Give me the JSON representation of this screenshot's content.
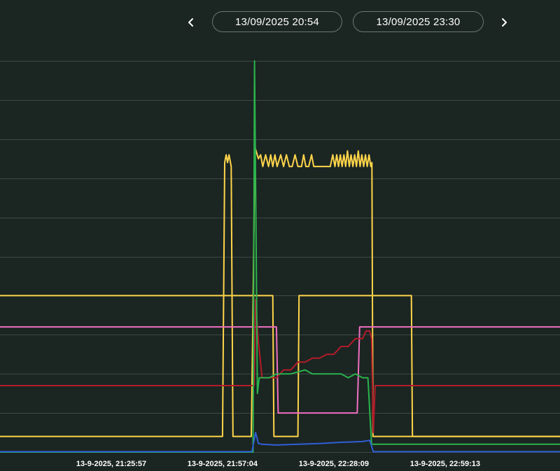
{
  "header": {
    "start_date": "13/09/2025 20:54",
    "end_date": "13/09/2025 23:30",
    "prev_icon": "chevron-left-icon",
    "next_icon": "chevron-right-icon"
  },
  "chart_data": {
    "type": "line",
    "title": "",
    "xlabel": "",
    "ylabel": "",
    "x_tick_labels": [
      "13-9-2025, 21:25:57",
      "13-9-2025, 21:57:04",
      "13-9-2025, 22:28:09",
      "13-9-2025, 22:59:13"
    ],
    "x_range_minutes": [
      -31,
      125
    ],
    "y_range": [
      0,
      10
    ],
    "grid": true,
    "legend": "none",
    "series": [
      {
        "color": "#ffd54a",
        "points": [
          [
            -31,
            4.0
          ],
          [
            45,
            4.0
          ],
          [
            45.3,
            0.4
          ],
          [
            52,
            0.4
          ],
          [
            52.3,
            4.0
          ],
          [
            83.6,
            4.0
          ],
          [
            83.9,
            0.4
          ],
          [
            125,
            0.4
          ]
        ]
      },
      {
        "color": "#ffd54a",
        "points": [
          [
            -31,
            0.4
          ],
          [
            31,
            0.4
          ],
          [
            31.6,
            7.4
          ],
          [
            32,
            7.6
          ],
          [
            32.4,
            7.4
          ],
          [
            32.8,
            7.6
          ],
          [
            33.4,
            7.3
          ],
          [
            33.9,
            0.4
          ],
          [
            39,
            0.4
          ],
          [
            39.4,
            3.0
          ],
          [
            40,
            7.8
          ],
          [
            41,
            7.5
          ],
          [
            41.6,
            7.6
          ],
          [
            42.2,
            7.3
          ],
          [
            43,
            7.6
          ],
          [
            43.8,
            7.3
          ],
          [
            44.4,
            7.6
          ],
          [
            45,
            7.3
          ],
          [
            45.6,
            7.6
          ],
          [
            46.2,
            7.3
          ],
          [
            47.2,
            7.6
          ],
          [
            48,
            7.3
          ],
          [
            48.8,
            7.6
          ],
          [
            49.6,
            7.3
          ],
          [
            50.4,
            7.3
          ],
          [
            51.2,
            7.6
          ],
          [
            52,
            7.3
          ],
          [
            53,
            7.3
          ],
          [
            53.6,
            7.6
          ],
          [
            54.2,
            7.3
          ],
          [
            55,
            7.3
          ],
          [
            55.8,
            7.6
          ],
          [
            56.4,
            7.3
          ],
          [
            58,
            7.3
          ],
          [
            60,
            7.3
          ],
          [
            61,
            7.3
          ],
          [
            61.7,
            7.6
          ],
          [
            62.3,
            7.3
          ],
          [
            62.8,
            7.6
          ],
          [
            63.3,
            7.3
          ],
          [
            63.8,
            7.6
          ],
          [
            64.3,
            7.3
          ],
          [
            64.8,
            7.6
          ],
          [
            65.3,
            7.3
          ],
          [
            65.8,
            7.7
          ],
          [
            66.3,
            7.3
          ],
          [
            66.8,
            7.6
          ],
          [
            67.3,
            7.3
          ],
          [
            67.8,
            7.6
          ],
          [
            68.3,
            7.3
          ],
          [
            68.8,
            7.7
          ],
          [
            69.3,
            7.3
          ],
          [
            69.8,
            7.6
          ],
          [
            70.3,
            7.3
          ],
          [
            70.8,
            7.6
          ],
          [
            71.3,
            7.3
          ],
          [
            71.8,
            7.6
          ],
          [
            72.3,
            7.3
          ],
          [
            72.6,
            7.4
          ],
          [
            72.9,
            0.4
          ],
          [
            125,
            0.4
          ]
        ]
      },
      {
        "color": "#f06fc0",
        "points": [
          [
            -31,
            3.2
          ],
          [
            46,
            3.2
          ],
          [
            46.5,
            1.0
          ],
          [
            68.5,
            1.0
          ],
          [
            69.2,
            3.2
          ],
          [
            125,
            3.2
          ]
        ]
      },
      {
        "color": "#b31c2a",
        "points": [
          [
            -31,
            1.7
          ],
          [
            39,
            1.7
          ],
          [
            39.8,
            1.7
          ],
          [
            40.2,
            3.9
          ],
          [
            41,
            2.8
          ],
          [
            42,
            1.9
          ],
          [
            46,
            1.9
          ],
          [
            48,
            2.1
          ],
          [
            50,
            2.1
          ],
          [
            52,
            2.3
          ],
          [
            54,
            2.3
          ],
          [
            56,
            2.4
          ],
          [
            58,
            2.4
          ],
          [
            60,
            2.5
          ],
          [
            62,
            2.5
          ],
          [
            64,
            2.7
          ],
          [
            66,
            2.7
          ],
          [
            68,
            2.9
          ],
          [
            70,
            2.9
          ],
          [
            71,
            3.1
          ],
          [
            72,
            3.1
          ],
          [
            72.5,
            2.9
          ],
          [
            73,
            0.5
          ],
          [
            73.5,
            1.7
          ],
          [
            125,
            1.7
          ]
        ]
      },
      {
        "color": "#2bb24c",
        "points": [
          [
            -31,
            0
          ],
          [
            39.5,
            0
          ],
          [
            39.9,
            10.0
          ],
          [
            40.3,
            6.0
          ],
          [
            40.7,
            1.5
          ],
          [
            41.2,
            1.9
          ],
          [
            42,
            1.9
          ],
          [
            44,
            1.9
          ],
          [
            46,
            2.0
          ],
          [
            50,
            2.0
          ],
          [
            54,
            2.1
          ],
          [
            56,
            2.0
          ],
          [
            58,
            2.0
          ],
          [
            60,
            2.0
          ],
          [
            64,
            2.0
          ],
          [
            66,
            1.9
          ],
          [
            68,
            2.0
          ],
          [
            70,
            1.9
          ],
          [
            71.5,
            1.9
          ],
          [
            72.5,
            0.2
          ],
          [
            125,
            0.2
          ]
        ]
      },
      {
        "color": "#2f5fd6",
        "points": [
          [
            -31,
            0.01
          ],
          [
            39.2,
            0.01
          ],
          [
            40.2,
            0.5
          ],
          [
            41,
            0.22
          ],
          [
            42,
            0.2
          ],
          [
            46,
            0.18
          ],
          [
            52,
            0.2
          ],
          [
            58,
            0.22
          ],
          [
            64,
            0.25
          ],
          [
            70,
            0.27
          ],
          [
            72,
            0.3
          ],
          [
            73,
            0.01
          ],
          [
            125,
            0.01
          ]
        ]
      }
    ]
  }
}
